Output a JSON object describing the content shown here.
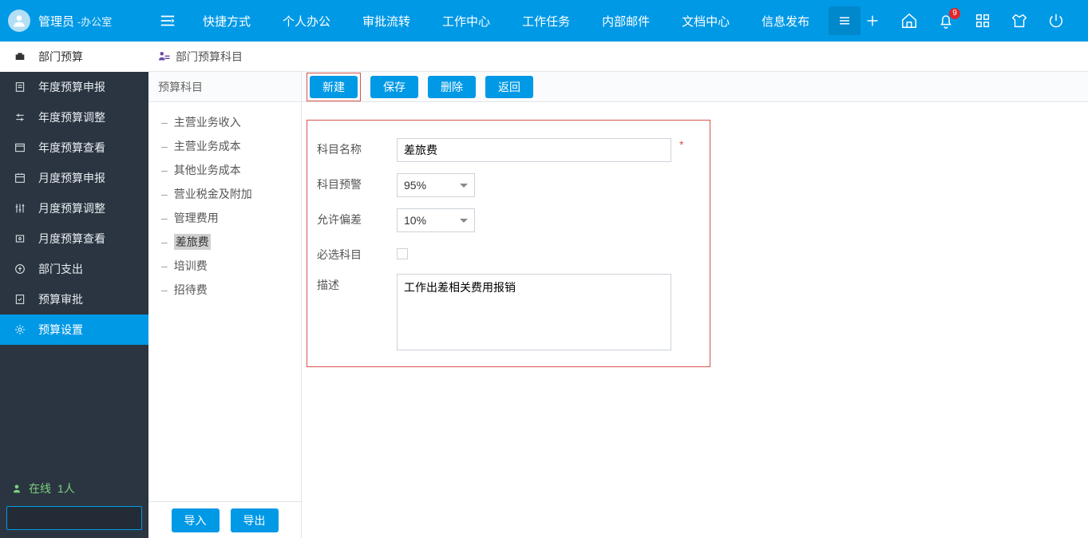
{
  "header": {
    "user_name": "管理员",
    "user_dept": "-办公室",
    "nav": [
      "快捷方式",
      "个人办公",
      "审批流转",
      "工作中心",
      "工作任务",
      "内部邮件",
      "文档中心",
      "信息发布"
    ],
    "notif_badge": "9"
  },
  "sidebar": {
    "items": [
      {
        "label": "部门预算"
      },
      {
        "label": "年度预算申报"
      },
      {
        "label": "年度预算调整"
      },
      {
        "label": "年度预算查看"
      },
      {
        "label": "月度预算申报"
      },
      {
        "label": "月度预算调整"
      },
      {
        "label": "月度预算查看"
      },
      {
        "label": "部门支出"
      },
      {
        "label": "预算审批"
      },
      {
        "label": "预算设置"
      }
    ],
    "online_prefix": "在线",
    "online_count": "1人"
  },
  "page": {
    "title": "部门预算科目",
    "mid_title": "预算科目",
    "subjects": [
      "主营业务收入",
      "主营业务成本",
      "其他业务成本",
      "营业税金及附加",
      "管理费用",
      "差旅费",
      "培训费",
      "招待费"
    ],
    "selected_subject_index": 5,
    "mid_buttons": {
      "import": "导入",
      "export": "导出"
    }
  },
  "toolbar": {
    "new": "新建",
    "save": "保存",
    "delete": "删除",
    "back": "返回"
  },
  "form": {
    "labels": {
      "name": "科目名称",
      "warn": "科目预警",
      "tolerance": "允许偏差",
      "required": "必选科目",
      "desc": "描述"
    },
    "name_value": "差旅费",
    "warn_value": "95%",
    "tolerance_value": "10%",
    "required_checked": false,
    "desc_value": "工作出差相关费用报销",
    "required_mark": "*"
  }
}
